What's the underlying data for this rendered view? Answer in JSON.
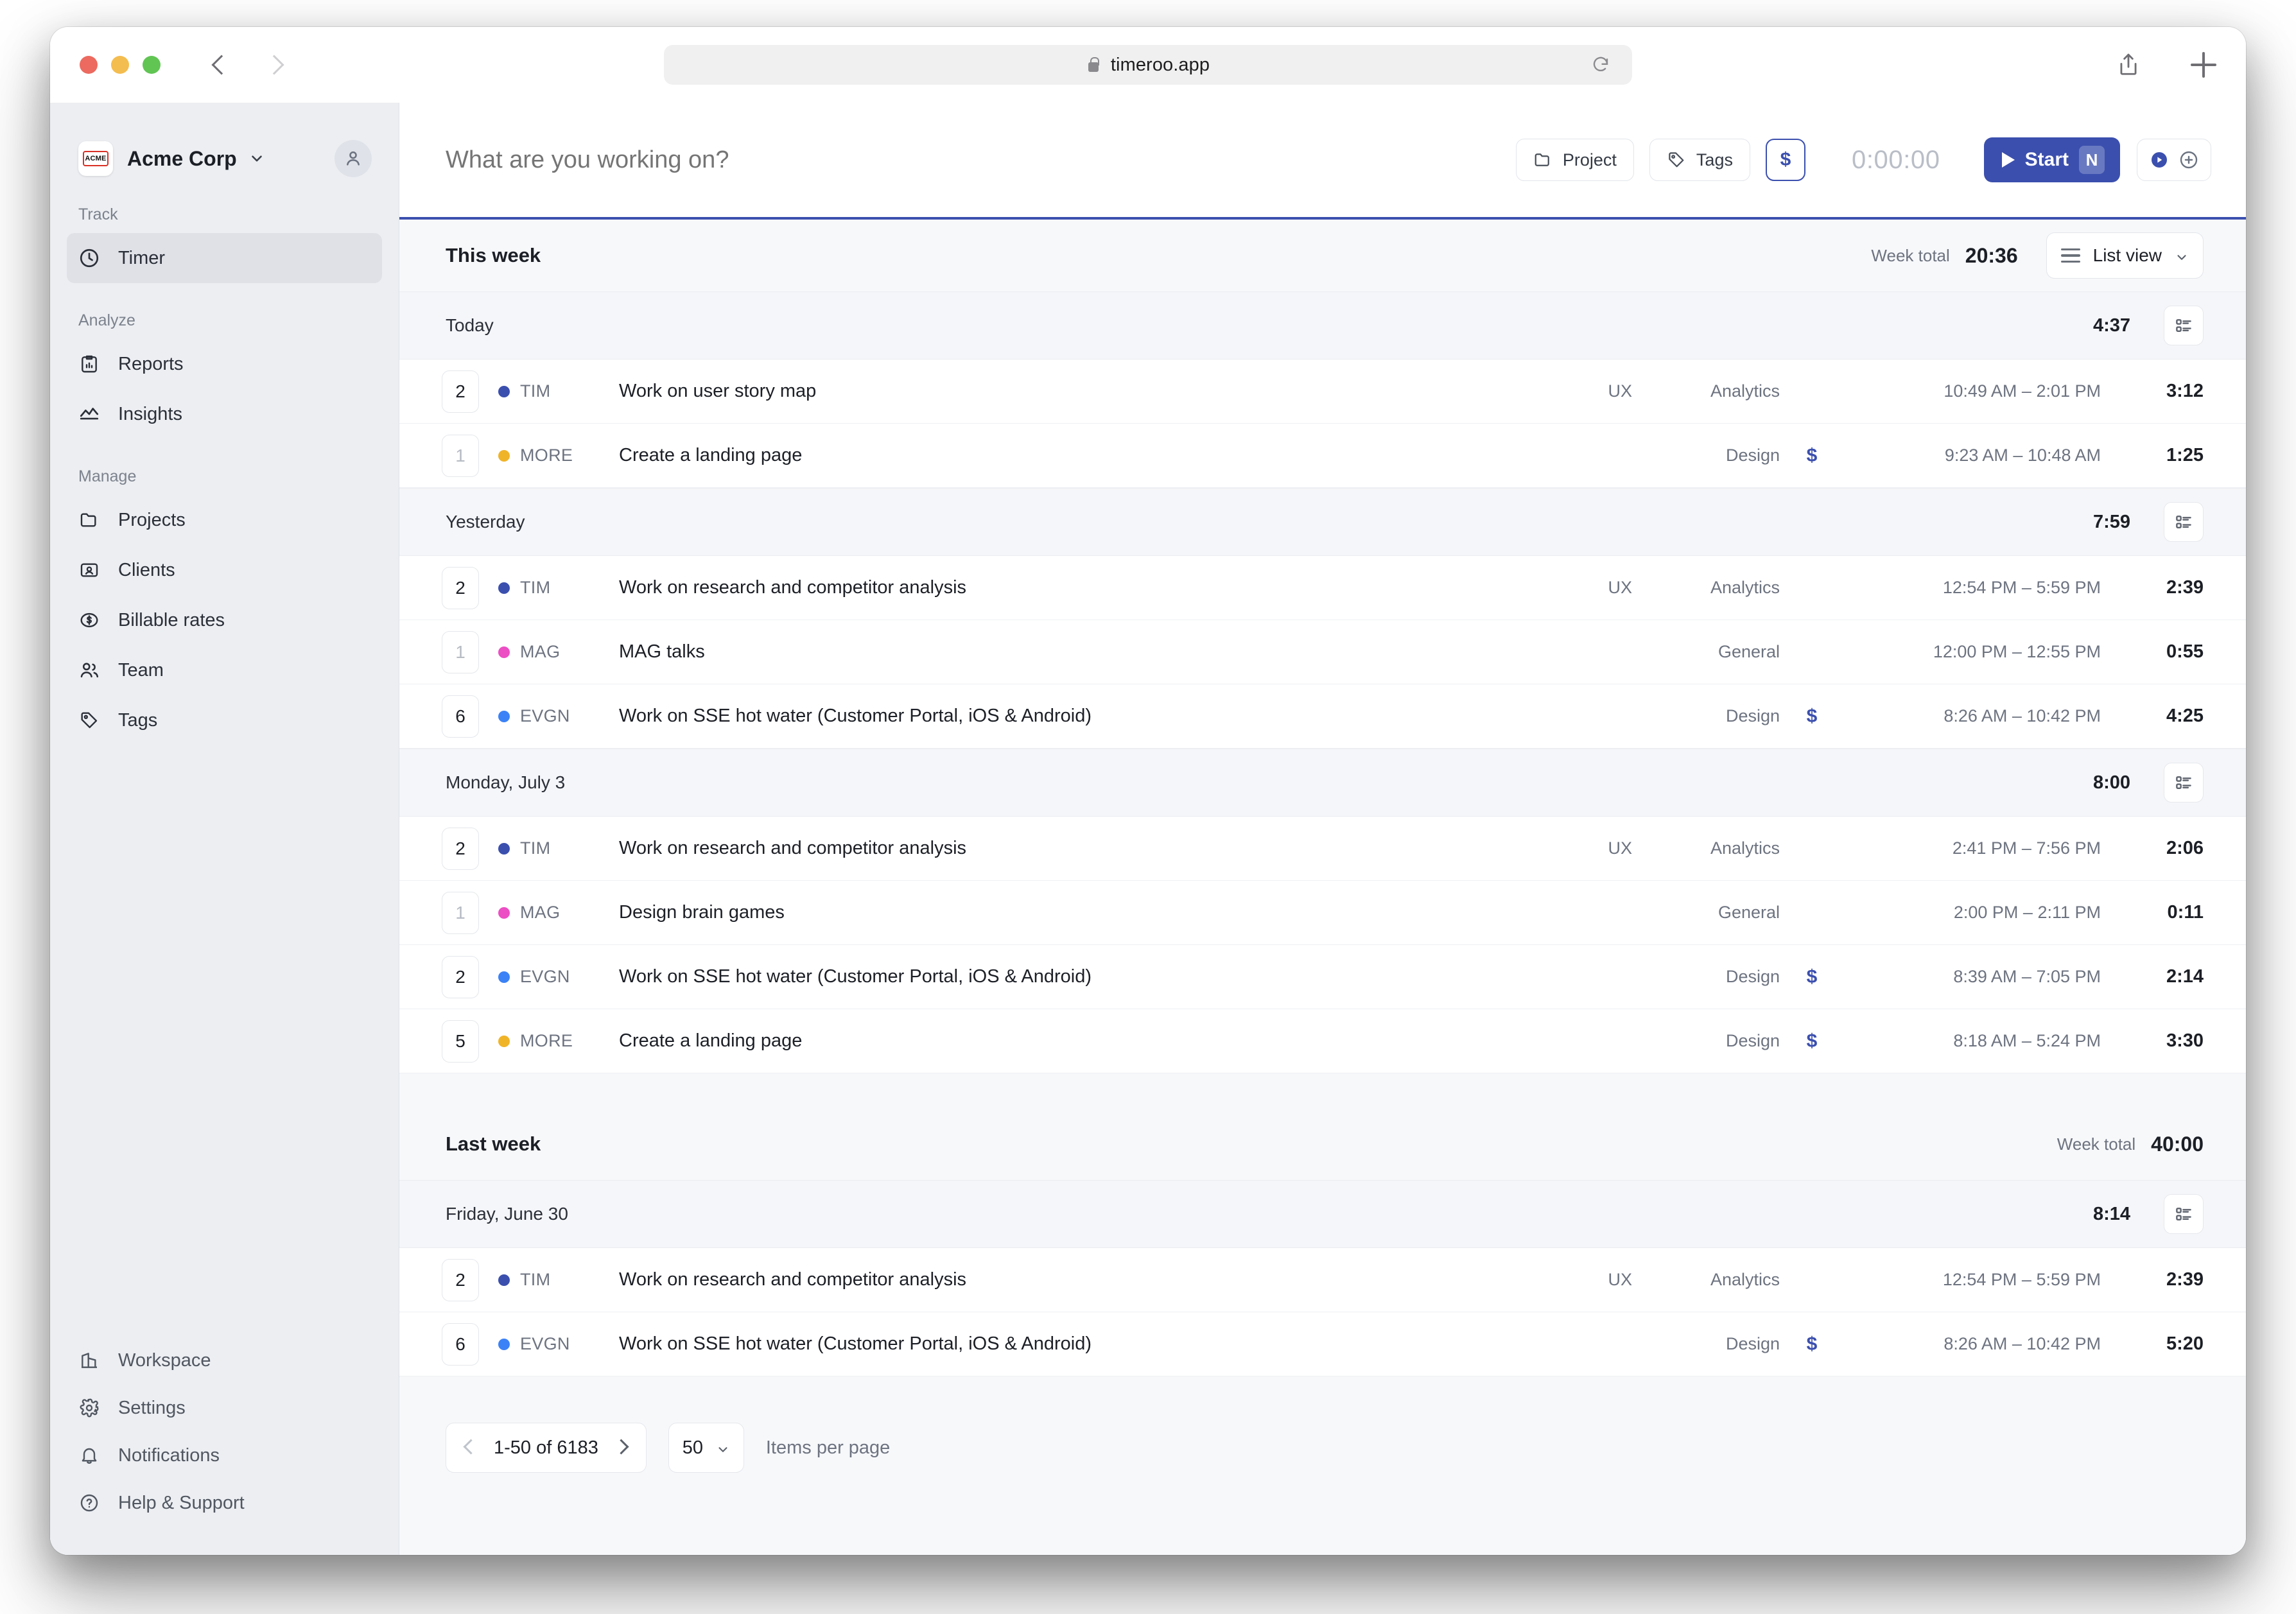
{
  "browser": {
    "url": "timeroo.app",
    "lock_icon": "lock-icon",
    "back_icon": "back-chevron-icon",
    "forward_icon": "forward-chevron-icon",
    "reload_icon": "reload-icon",
    "share_icon": "share-icon",
    "new_tab_icon": "plus-icon"
  },
  "sidebar": {
    "workspace": {
      "name": "Acme Corp",
      "logo_text": "ACME",
      "caret_icon": "chevron-down-icon",
      "avatar_icon": "user-avatar-icon"
    },
    "groups": [
      {
        "label": "Track",
        "items": [
          {
            "label": "Timer",
            "icon": "clock-icon",
            "active": true
          }
        ]
      },
      {
        "label": "Analyze",
        "items": [
          {
            "label": "Reports",
            "icon": "clipboard-chart-icon",
            "active": false
          },
          {
            "label": "Insights",
            "icon": "trend-line-icon",
            "active": false
          }
        ]
      },
      {
        "label": "Manage",
        "items": [
          {
            "label": "Projects",
            "icon": "folder-icon",
            "active": false
          },
          {
            "label": "Clients",
            "icon": "id-card-icon",
            "active": false
          },
          {
            "label": "Billable rates",
            "icon": "dollar-circle-icon",
            "active": false
          },
          {
            "label": "Team",
            "icon": "people-icon",
            "active": false
          },
          {
            "label": "Tags",
            "icon": "tag-icon",
            "active": false
          }
        ]
      }
    ],
    "bottom_items": [
      {
        "label": "Workspace",
        "icon": "building-icon"
      },
      {
        "label": "Settings",
        "icon": "gear-icon"
      },
      {
        "label": "Notifications",
        "icon": "bell-icon"
      },
      {
        "label": "Help & Support",
        "icon": "question-circle-icon"
      }
    ]
  },
  "timer_bar": {
    "placeholder": "What are you working on?",
    "value": "",
    "project_button": {
      "label": "Project",
      "icon": "folder-icon"
    },
    "tags_button": {
      "label": "Tags",
      "icon": "tag-icon"
    },
    "billable_button": {
      "label": "$",
      "icon": "dollar-icon",
      "active": true
    },
    "readout": "0:00:00",
    "start_button": {
      "label": "Start",
      "shortcut": "N",
      "icon": "play-icon"
    },
    "mode_toggle": {
      "timer_icon": "play-circle-icon",
      "manual_icon": "plus-circle-icon"
    },
    "accent_color": "#3b4fae"
  },
  "list": {
    "view_button": {
      "label": "List view",
      "icon": "list-lines-icon",
      "caret": "chevron-down-icon"
    },
    "week_total_label": "Week total",
    "day_action_icon": "list-detail-icon",
    "weeks": [
      {
        "title": "This week",
        "total": "20:36",
        "days": [
          {
            "name": "Today",
            "total": "4:37",
            "entries": [
              {
                "count": "2",
                "count_dim": false,
                "color": "#3b4fae",
                "code": "TIM",
                "desc": "Work on user story map",
                "tag": "UX",
                "client": "Analytics",
                "billable": "",
                "range": "10:49 AM – 2:01 PM",
                "duration": "3:12"
              },
              {
                "count": "1",
                "count_dim": true,
                "color": "#f0b429",
                "code": "MORE",
                "desc": "Create a landing page",
                "tag": "",
                "client": "Design",
                "billable": "$",
                "range": "9:23 AM – 10:48 AM",
                "duration": "1:25"
              }
            ]
          },
          {
            "name": "Yesterday",
            "total": "7:59",
            "entries": [
              {
                "count": "2",
                "count_dim": false,
                "color": "#3b4fae",
                "code": "TIM",
                "desc": "Work on research and competitor analysis",
                "tag": "UX",
                "client": "Analytics",
                "billable": "",
                "range": "12:54 PM – 5:59 PM",
                "duration": "2:39"
              },
              {
                "count": "1",
                "count_dim": true,
                "color": "#ec4ec4",
                "code": "MAG",
                "desc": "MAG talks",
                "tag": "",
                "client": "General",
                "billable": "",
                "range": "12:00 PM – 12:55 PM",
                "duration": "0:55"
              },
              {
                "count": "6",
                "count_dim": false,
                "color": "#3b82f6",
                "code": "EVGN",
                "desc": "Work on SSE hot water (Customer Portal, iOS & Android)",
                "tag": "",
                "client": "Design",
                "billable": "$",
                "range": "8:26 AM – 10:42 PM",
                "duration": "4:25"
              }
            ]
          },
          {
            "name": "Monday, July 3",
            "total": "8:00",
            "entries": [
              {
                "count": "2",
                "count_dim": false,
                "color": "#3b4fae",
                "code": "TIM",
                "desc": "Work on research and competitor analysis",
                "tag": "UX",
                "client": "Analytics",
                "billable": "",
                "range": "2:41 PM – 7:56 PM",
                "duration": "2:06"
              },
              {
                "count": "1",
                "count_dim": true,
                "color": "#ec4ec4",
                "code": "MAG",
                "desc": "Design brain games",
                "tag": "",
                "client": "General",
                "billable": "",
                "range": "2:00 PM – 2:11 PM",
                "duration": "0:11"
              },
              {
                "count": "2",
                "count_dim": false,
                "color": "#3b82f6",
                "code": "EVGN",
                "desc": "Work on SSE hot water (Customer Portal, iOS & Android)",
                "tag": "",
                "client": "Design",
                "billable": "$",
                "range": "8:39 AM – 7:05 PM",
                "duration": "2:14"
              },
              {
                "count": "5",
                "count_dim": false,
                "color": "#f0b429",
                "code": "MORE",
                "desc": "Create a landing page",
                "tag": "",
                "client": "Design",
                "billable": "$",
                "range": "8:18 AM – 5:24 PM",
                "duration": "3:30"
              }
            ]
          }
        ]
      },
      {
        "title": "Last week",
        "total": "40:00",
        "days": [
          {
            "name": "Friday, June 30",
            "total": "8:14",
            "entries": [
              {
                "count": "2",
                "count_dim": false,
                "color": "#3b4fae",
                "code": "TIM",
                "desc": "Work on research and competitor analysis",
                "tag": "UX",
                "client": "Analytics",
                "billable": "",
                "range": "12:54 PM – 5:59 PM",
                "duration": "2:39"
              },
              {
                "count": "6",
                "count_dim": false,
                "color": "#3b82f6",
                "code": "EVGN",
                "desc": "Work on SSE hot water (Customer Portal, iOS & Android)",
                "tag": "",
                "client": "Design",
                "billable": "$",
                "range": "8:26 AM – 10:42 PM",
                "duration": "5:20"
              }
            ]
          }
        ]
      }
    ]
  },
  "pagination": {
    "range_label": "1-50 of 6183",
    "prev_icon": "chevron-left-icon",
    "next_icon": "chevron-right-icon",
    "per_page_value": "50",
    "per_page_label": "Items per page",
    "per_page_caret": "chevron-down-icon"
  }
}
